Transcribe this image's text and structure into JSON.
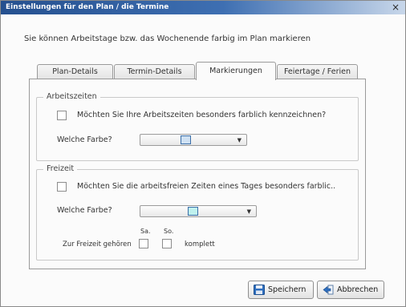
{
  "window": {
    "title": "Einstellungen für den Plan / die Termine",
    "close_glyph": "×"
  },
  "intro_text": "Sie können Arbeitstage bzw. das Wochenende farbig im Plan markieren",
  "tabs": [
    {
      "label": "Plan-Details",
      "active": false
    },
    {
      "label": "Termin-Details",
      "active": false
    },
    {
      "label": "Markierungen",
      "active": true
    },
    {
      "label": "Feiertage / Ferien",
      "active": false
    }
  ],
  "arbeitszeiten": {
    "legend": "Arbeitszeiten",
    "checkbox_label": "Möchten Sie Ihre Arbeitszeiten besonders farblich kennzeichnen?",
    "checked": false,
    "color_label": "Welche Farbe?",
    "color_value": "#cfe1f3"
  },
  "freizeit": {
    "legend": "Freizeit",
    "checkbox_label": "Möchten Sie die arbeitsfreien Zeiten eines Tages besonders farblic..",
    "checked": false,
    "color_label": "Welche Farbe?",
    "color_value": "#bff1ee",
    "day_sa": "Sa.",
    "day_so": "So.",
    "weekend_label": "Zur Freizeit gehören",
    "komplett_label": "komplett"
  },
  "buttons": {
    "save": "Speichern",
    "cancel": "Abbrechen"
  },
  "icons": {
    "save": "floppy-disk-icon",
    "cancel": "cancel-arrow-icon",
    "dropdown": "▼"
  }
}
